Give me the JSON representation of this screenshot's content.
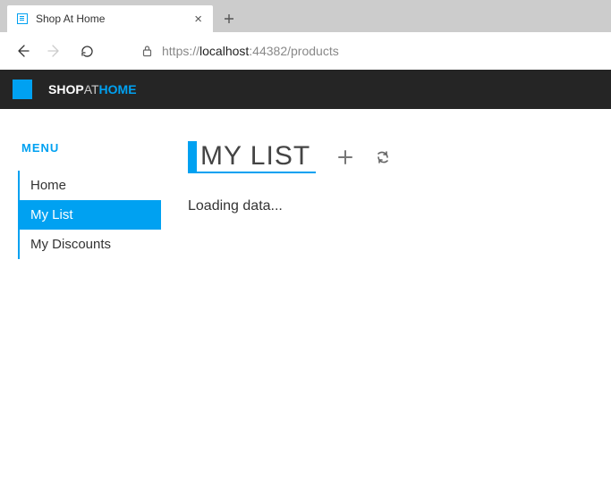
{
  "browser": {
    "tab_title": "Shop At Home",
    "url_prefix": "https://",
    "url_host_gray": "localhost",
    "url_rest": ":44382/products"
  },
  "brand": {
    "part1": "SHOP",
    "part2": "AT",
    "part3": "HOME"
  },
  "sidebar": {
    "label": "MENU",
    "items": [
      {
        "label": "Home"
      },
      {
        "label": "My List"
      },
      {
        "label": "My Discounts"
      }
    ],
    "active_index": 1
  },
  "main": {
    "title": "MY LIST",
    "loading_text": "Loading data..."
  }
}
